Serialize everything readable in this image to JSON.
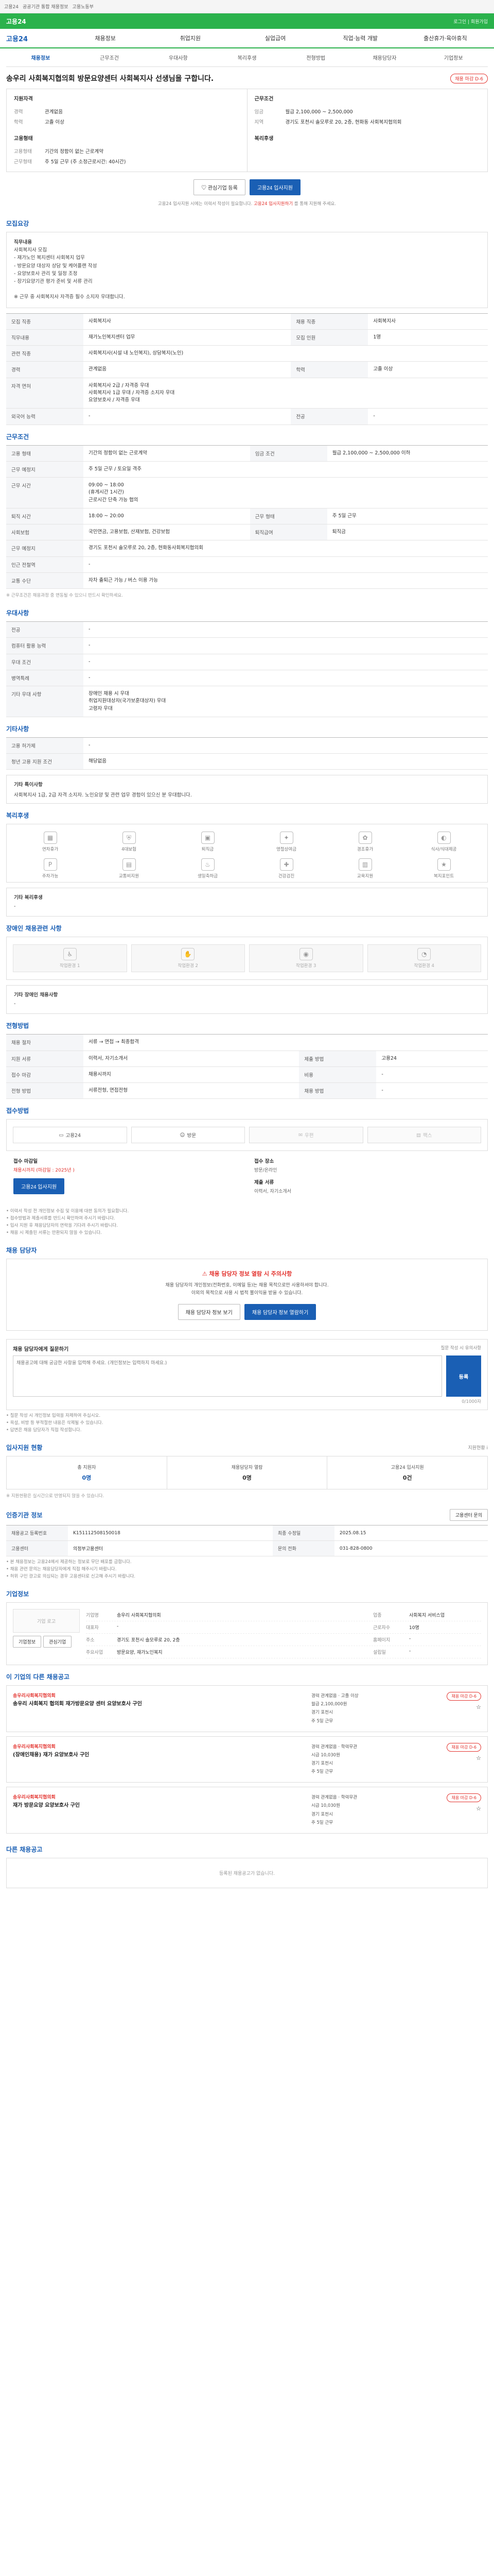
{
  "topbar": {
    "items": [
      "고용24",
      "공공기관 통합 채용정보",
      "고용노동부"
    ]
  },
  "gnb": {
    "brand": "고용24",
    "right": "로그인 | 회원가입"
  },
  "menu": {
    "logo": "고용24",
    "items": [
      "채용정보",
      "취업지원",
      "실업급여",
      "직업·능력 개발",
      "출산휴가·육아휴직"
    ]
  },
  "subtabs": [
    "채용정보",
    "근무조건",
    "우대사항",
    "복리후생",
    "전형방법",
    "채용담당자",
    "기업정보"
  ],
  "title": {
    "text": "송우리 사회복지협의회 방문요양센터 사회복지사 선생님을 구합니다.",
    "badge": "채용 마감 D-6"
  },
  "summary": {
    "left_title": "지원자격",
    "left": [
      {
        "k": "경력",
        "v": "관계없음"
      },
      {
        "k": "학력",
        "v": "고졸 이상"
      }
    ],
    "left_title2": "고용형태",
    "left2": [
      {
        "k": "고용형태",
        "v": "기간의 정함이 없는 근로계약"
      },
      {
        "k": "근무형태",
        "v": "주 5일 근무 (주 소정근로시간: 40시간)"
      }
    ],
    "right_title": "근무조건",
    "right": [
      {
        "k": "임금",
        "v": "월급 2,100,000 ~ 2,500,000"
      },
      {
        "k": "지역",
        "v": "경기도 포천시 솔모루로 20, 2층, 현화동 사회복지협의회"
      }
    ],
    "right_title2": "복리후생",
    "right2": []
  },
  "apply": {
    "btn1": "관심기업 등록",
    "btn2": "고용24 입사지원",
    "note_a": "고용24 입사지원 시에는 이력서 작성이 필요합니다.",
    "note_red": "고용24 입사지원하기",
    "note_b": "를 통해 지원해 주세요."
  },
  "sections": {
    "recruit": "모집요강",
    "work": "근무조건",
    "pref": "우대사항",
    "other": "기타사항",
    "welfare": "복리후생",
    "disability": "장애인 채용관련 사항",
    "process": "전형방법",
    "method": "접수방법",
    "contact": "채용 담당자",
    "qa": "채용 담당자에게 질문하기",
    "applicants": "입사지원 현황",
    "info": "인증기관 정보",
    "company": "기업정보",
    "related": "이 기업의 다른 채용공고",
    "others": "다른 채용공고"
  },
  "recruit": {
    "body_title": "직무내용",
    "body": "사회복지사 모집\n- 재가노인 복지센터 사회복지 업무\n- 방문요양 대상자 상담 및 케어플랜 작성\n- 요양보호사 관리 및 일정 조정\n- 장기요양기관 평가 준비 및 서류 관리\n\n※ 근무 중 사회복지사 자격증 필수 소지자 우대합니다.",
    "rows": [
      {
        "k": "모집 직종",
        "v": "사회복지사",
        "k2": "채용 직종",
        "v2": "사회복지사"
      },
      {
        "k": "직무내용",
        "v": "재가노인복지센터 업무",
        "k2": "모집 인원",
        "v2": "1명"
      },
      {
        "k": "관련 직종",
        "v": "사회복지사(시설 내 노인복지), 상담복지(노인)"
      },
      {
        "k": "경력",
        "v": "관계없음",
        "k2": "학력",
        "v2": "고졸 이상"
      },
      {
        "k": "자격 면허",
        "v": "사회복지사 2급 / 자격증 우대\n사회복지사 1급 우대 / 자격증 소지자 우대\n요양보호사 / 자격증 우대"
      },
      {
        "k": "외국어 능력",
        "v": "-",
        "k2": "전공",
        "v2": "-"
      }
    ]
  },
  "work": {
    "rows": [
      {
        "k": "고용 형태",
        "v": "기간의 정함이 없는 근로계약",
        "k2": "임금 조건",
        "v2": "월급 2,100,000 ~ 2,500,000 이하"
      },
      {
        "k": "근무 예정지",
        "v": "주 5일 근무 / 토요일 격주"
      },
      {
        "k": "근무 시간",
        "v": "09:00 ~ 18:00\n(휴게시간 1시간)\n근로시간 단축 가능 협의"
      },
      {
        "k": "퇴직 시간",
        "v": "18:00 ~ 20:00",
        "k2": "근무 형태",
        "v2": "주 5일 근무"
      },
      {
        "k": "사회보험",
        "v": "국민연금, 고용보험, 산재보험, 건강보험",
        "k2": "퇴직급여",
        "v2": "퇴직금"
      },
      {
        "k": "근무 예정지",
        "v": "경기도 포천시 솔모루로 20, 2층, 현화동사회복지협의회"
      },
      {
        "k": "인근 전철역",
        "v": "-"
      },
      {
        "k": "교통 수단",
        "v": "자차 출퇴근 가능 / 버스 이용 가능"
      }
    ],
    "footnote": "※ 근무조건은 채용과정 중 변동될 수 있으니 반드시 확인하세요."
  },
  "pref": {
    "rows": [
      {
        "k": "전공",
        "v": "-"
      },
      {
        "k": "컴퓨터 활용 능력",
        "v": "-"
      },
      {
        "k": "우대 조건",
        "v": "-"
      },
      {
        "k": "병역특례",
        "v": "-"
      },
      {
        "k": "기타 우대 사항",
        "v": "장애인 채용 시 우대\n취업지원대상자(국가보훈대상자) 우대\n고령자 우대"
      }
    ]
  },
  "other": {
    "rows": [
      {
        "k": "고용 허가제",
        "v": "-"
      },
      {
        "k": "청년 고용 지원 조건",
        "v": "해당없음"
      }
    ],
    "box_title": "기타 특이사항",
    "box": "사회복지사 1급, 2급 자격 소지자. 노인요양 및 관련 업무 경험이 있으신 분 우대합니다."
  },
  "welfare": {
    "items": [
      "연차휴가",
      "4대보험",
      "퇴직금",
      "명절상여금",
      "경조휴가",
      "식사/식대제공",
      "주차가능",
      "교통비지원",
      "생일축하금",
      "건강검진",
      "교육지원",
      "복지포인트"
    ],
    "box_title": "기타 복리후생",
    "box": "-"
  },
  "disability": {
    "items": [
      "작업환경 1",
      "작업환경 2",
      "작업환경 3",
      "작업환경 4"
    ],
    "box_title": "기타 장애인 채용사항",
    "box": "-"
  },
  "process": {
    "rows": [
      {
        "k": "채용 절차",
        "v": "서류 → 면접 → 최종합격"
      },
      {
        "k": "지원 서류",
        "v": "이력서, 자기소개서",
        "k2": "제출 방법",
        "v2": "고용24"
      },
      {
        "k": "접수 마감",
        "v": "채용시까지",
        "k2": "비용",
        "v2": "-"
      },
      {
        "k": "전형 방법",
        "v": "서류전형, 면접전형",
        "k2": "채용 방법",
        "v2": "-"
      }
    ]
  },
  "method": {
    "items": [
      {
        "label": "고용24",
        "on": true
      },
      {
        "label": "방문",
        "on": true
      },
      {
        "label": "우편",
        "on": false
      },
      {
        "label": "팩스",
        "on": false
      }
    ],
    "left_label": "접수 마감일",
    "left_val": "채용시까지 (마감일 : 2025년 )",
    "right_label": "접수 장소",
    "right_val": "방문/온라인",
    "right_label2": "제출 서류",
    "right_val2": "이력서, 자기소개서",
    "apply_btn": "고용24 입사지원",
    "bullets": [
      "이력서 작성 전 개인정보 수집 및 이용에 대한 동의가 필요합니다.",
      "접수방법과 제출서류를 반드시 확인하여 주시기 바랍니다.",
      "입사 지원 후 채용담당자의 연락을 기다려 주시기 바랍니다.",
      "채용 시 제출된 서류는 반환되지 않을 수 있습니다."
    ]
  },
  "contact": {
    "title": "채용 담당자 정보 열람 시 주의사항",
    "sub1": "채용 담당자의 개인정보(전화번호, 이메일 등)는 채용 목적으로만 사용하셔야 합니다.",
    "sub2": "이외의 목적으로 사용 시 법적 불이익을 받을 수 있습니다.",
    "btn1": "채용 담당자 정보 보기",
    "btn2": "채용 담당자 정보 열람하기"
  },
  "qa": {
    "title": "채용 담당자에게 질문하기",
    "right": "질문 작성 시 유의사항",
    "placeholder": "채용공고에 대해 궁금한 사항을 입력해 주세요. (개인정보는 입력하지 마세요.)",
    "send": "등록",
    "count": "0/1000자",
    "bullets": [
      "질문 작성 시 개인정보 입력을 자제하여 주십시오.",
      "욕설, 비방 등 부적절한 내용은 삭제될 수 있습니다.",
      "답변은 채용 담당자가 직접 작성합니다."
    ]
  },
  "applicants": {
    "right": "지원현황 i",
    "items": [
      {
        "label": "총 지원자",
        "value": "0명",
        "blue": true
      },
      {
        "label": "채용담당자 열람",
        "value": "0명",
        "blue": false
      },
      {
        "label": "고용24 입사지원",
        "value": "0건",
        "blue": false
      }
    ],
    "note": "※ 지원현황은 실시간으로 반영되지 않을 수 있습니다."
  },
  "info": {
    "right": "고용센터 문의",
    "rows": [
      {
        "k": "채용공고 등록번호",
        "v": "K151112508150018",
        "k2": "최종 수정일",
        "v2": "2025.08.15"
      },
      {
        "k": "고용센터",
        "v": "의정부고용센터",
        "k2": "문의 전화",
        "v2": "031-828-0800"
      }
    ],
    "bullets": [
      "본 채용정보는 고용24에서 제공하는 정보로 무단 배포를 금합니다.",
      "채용 관련 문의는 채용담당자에게 직접 해주시기 바랍니다.",
      "허위 구인 광고로 의심되는 경우 고용센터로 신고해 주시기 바랍니다."
    ]
  },
  "company": {
    "logo": "기업 로고",
    "btn1": "기업정보",
    "btn2": "관심기업",
    "rows": [
      {
        "k": "기업명",
        "v": "송우리 사회복지협의회",
        "k2": "업종",
        "v2": "사회복지 서비스업"
      },
      {
        "k": "대표자",
        "v": "-",
        "k2": "근로자수",
        "v2": "10명"
      },
      {
        "k": "주소",
        "v": "경기도 포천시 솔모루로 20, 2층",
        "k2": "홈페이지",
        "v2": "-"
      },
      {
        "k": "주요사업",
        "v": "방문요양, 재가노인복지",
        "k2": "설립일",
        "v2": "-"
      }
    ]
  },
  "related": {
    "items": [
      {
        "cname": "송우리사회복지협의회",
        "title": "송우리 사회복지 협의회 재가방문요양 센터 요양보호사 구인",
        "meta": [
          "경력 관계없음 · 고졸 이상",
          "월급 2,100,000원",
          "경기 포천시",
          "주 5일 근무"
        ],
        "pill": "채용 마감 D-6"
      },
      {
        "cname": "송우리사회복지협의회",
        "title": "(장애인채용) 재가 요양보호사 구인",
        "meta": [
          "경력 관계없음 · 학력무관",
          "시급 10,030원",
          "경기 포천시",
          "주 5일 근무"
        ],
        "pill": "채용 마감 D-6"
      },
      {
        "cname": "송우리사회복지협의회",
        "title": "재가 방문요양 요양보호사 구인",
        "meta": [
          "경력 관계없음 · 학력무관",
          "시급 10,030원",
          "경기 포천시",
          "주 5일 근무"
        ],
        "pill": "채용 마감 D-6"
      }
    ]
  },
  "others": {
    "empty": "등록된 채용공고가 없습니다."
  }
}
